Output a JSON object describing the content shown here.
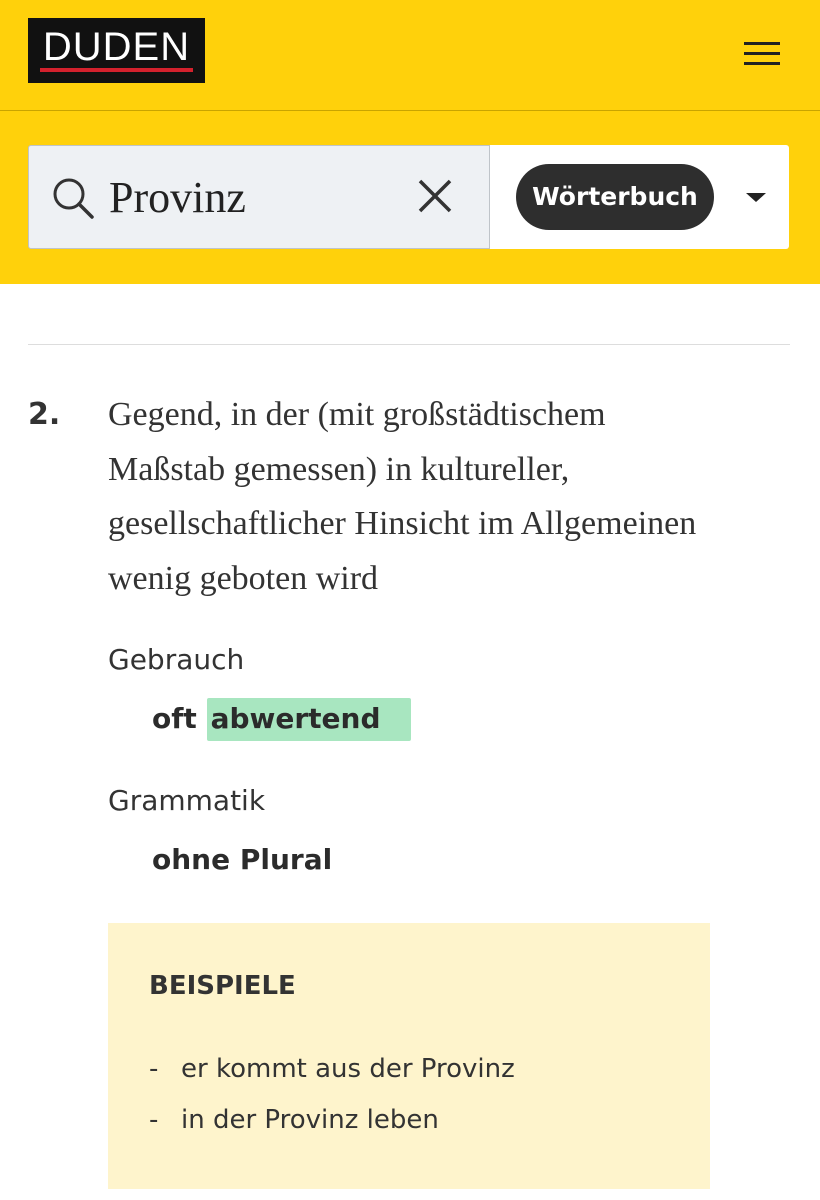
{
  "header": {
    "logo_text": "DUDEN",
    "menu_icon": "hamburger-menu-icon",
    "background": "#ffd10b"
  },
  "search": {
    "query": "Provinz",
    "search_icon": "search-icon",
    "clear_icon": "close-icon",
    "dictionary_label": "Wörterbuch",
    "dropdown_icon": "caret-down-icon"
  },
  "entry": {
    "number": "2.",
    "definition": "Gegend, in der (mit großstädtischem Maßstab gemessen) in kultureller, gesellschaftlicher Hinsicht im Allgemeinen wenig geboten wird",
    "usage": {
      "label": "Gebrauch",
      "prefix": "oft",
      "value": "abwertend",
      "highlight_color": "#a8e6c0"
    },
    "grammar": {
      "label": "Grammatik",
      "value": "ohne Plural"
    },
    "examples": {
      "title": "BEISPIELE",
      "background": "#fef4cc",
      "items": [
        "er kommt aus der Provinz",
        "in der Provinz leben"
      ]
    }
  }
}
